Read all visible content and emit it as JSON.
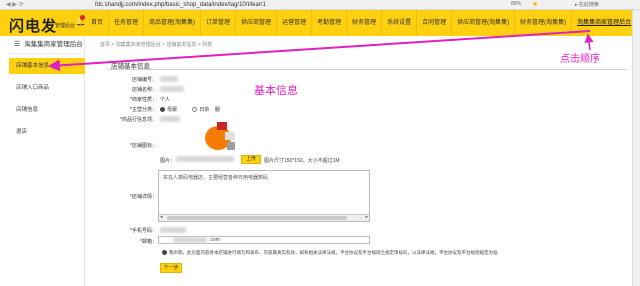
{
  "browser": {
    "nav_glyphs": "◀ ▶ ⟳",
    "url": "fdc.shandjj.com/index.php/basic_shop_data/index/tag/10/t/lear/1",
    "zoom": "85%",
    "search_placeholder": "▸ 在此搜索"
  },
  "topnav": {
    "logo": "闪电发",
    "logo_sub": "管理后台",
    "items": [
      "首页",
      "任务管理",
      "商品管理(淘集集)",
      "订单管理",
      "供应商管理",
      "运营管理",
      "考勤管理",
      "财务管理",
      "系统设置",
      "合同管理",
      "供应商管理(淘集集)",
      "财务管理(淘集集)",
      "淘集集商家管理后台"
    ],
    "active_index": 12,
    "accent": "#ffd00f"
  },
  "sidebar": {
    "title": "淘集集商家管理后台",
    "items": [
      "店铺基本信息",
      "店铺入口商品",
      "店铺信息",
      "退店"
    ],
    "active_index": 0
  },
  "breadcrumb": "首页 > 淘集集商家管理后台 > 店铺基本信息 > 列表",
  "panel": {
    "title": "店铺基本信息",
    "labels": {
      "shop_no": "店铺编号：",
      "shop_name": "店铺名称：",
      "nature": "*商家性质：",
      "category": "*主营分类：",
      "ad_position": "*商品行信息项：",
      "logo": "*店铺图标：",
      "picture": "图片：",
      "desc": "*店铺详情：",
      "phone": "*手机号码：",
      "email": "*邮箱："
    },
    "values": {
      "nature": "个人",
      "category_a": "母婴",
      "category_b": "日杂",
      "category_c": "服"
    },
    "upload_button": "上传",
    "upload_hint": "图片尺寸150*150，大小不超过1M",
    "desc_text": "实在人数码电器店，主要经营各种日用电器数码",
    "email_suffix": ".com",
    "agreement": "我声明，此页面内容各本店铺进行填写和发布，内容属真实有效，如有相关法律法规，平台协议及平台规则之规定审核的，以法律法规，平台协议及平台规则规定为准",
    "next_button": "下一步"
  },
  "annotations": {
    "basic_info": "基本信息",
    "click_order": "点击顺序",
    "color": "#e020c0"
  }
}
